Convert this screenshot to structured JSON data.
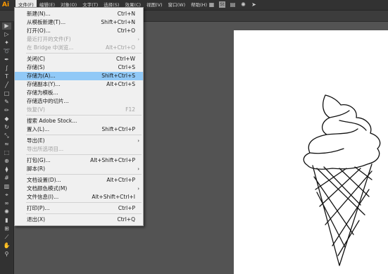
{
  "app": {
    "logo": "Ai"
  },
  "menubar": {
    "items": [
      {
        "label": "文件(F)",
        "active": true
      },
      {
        "label": "编辑(E)"
      },
      {
        "label": "对象(O)"
      },
      {
        "label": "文字(T)"
      },
      {
        "label": "选择(S)"
      },
      {
        "label": "效果(C)"
      },
      {
        "label": "视图(V)"
      },
      {
        "label": "窗口(W)"
      },
      {
        "label": "帮助(H)"
      }
    ],
    "icons": [
      "grid-icon",
      "stock-icon",
      "layout-icon",
      "star-burst-icon",
      "send-icon"
    ]
  },
  "file_menu": {
    "items": [
      {
        "label": "新建(N)...",
        "shortcut": "Ctrl+N"
      },
      {
        "label": "从模板新建(T)...",
        "shortcut": "Shift+Ctrl+N"
      },
      {
        "label": "打开(O)...",
        "shortcut": "Ctrl+O"
      },
      {
        "label": "最近打开的文件(F)",
        "shortcut": "",
        "submenu": true,
        "disabled": true
      },
      {
        "label": "在 Bridge 中浏览...",
        "shortcut": "Alt+Ctrl+O",
        "disabled": true
      },
      {
        "label": "关闭(C)",
        "shortcut": "Ctrl+W"
      },
      {
        "label": "存储(S)",
        "shortcut": "Ctrl+S"
      },
      {
        "label": "存储为(A)...",
        "shortcut": "Shift+Ctrl+S",
        "highlighted": true
      },
      {
        "label": "存储副本(Y)...",
        "shortcut": "Alt+Ctrl+S"
      },
      {
        "label": "存储为模板...",
        "shortcut": ""
      },
      {
        "label": "存储选中的切片...",
        "shortcut": ""
      },
      {
        "label": "恢复(V)",
        "shortcut": "F12",
        "disabled": true
      },
      {
        "label": "搜索 Adobe Stock...",
        "shortcut": ""
      },
      {
        "label": "置入(L)...",
        "shortcut": "Shift+Ctrl+P"
      },
      {
        "label": "导出(E)",
        "shortcut": "",
        "submenu": true
      },
      {
        "label": "导出所选项目...",
        "shortcut": "",
        "disabled": true
      },
      {
        "label": "打包(G)...",
        "shortcut": "Alt+Shift+Ctrl+P"
      },
      {
        "label": "脚本(R)",
        "shortcut": "",
        "submenu": true
      },
      {
        "label": "文档设置(D)...",
        "shortcut": "Alt+Ctrl+P"
      },
      {
        "label": "文档颜色模式(M)",
        "shortcut": "",
        "submenu": true
      },
      {
        "label": "文件信息(I)...",
        "shortcut": "Alt+Shift+Ctrl+I"
      },
      {
        "label": "打印(P)...",
        "shortcut": "Ctrl+P"
      },
      {
        "label": "退出(X)",
        "shortcut": "Ctrl+Q"
      }
    ]
  },
  "toolbar": {
    "tools": [
      "selection-tool-icon",
      "direct-selection-tool-icon",
      "magic-wand-icon",
      "lasso-icon",
      "pen-tool-icon",
      "curvature-tool-icon",
      "type-tool-icon",
      "line-tool-icon",
      "rectangle-tool-icon",
      "paintbrush-icon",
      "pencil-icon",
      "eraser-icon",
      "rotate-tool-icon",
      "scale-tool-icon",
      "width-tool-icon",
      "free-transform-icon",
      "shape-builder-icon",
      "perspective-grid-icon",
      "mesh-tool-icon",
      "gradient-tool-icon",
      "eyedropper-icon",
      "blend-tool-icon",
      "symbol-sprayer-icon",
      "column-graph-icon",
      "artboard-tool-icon",
      "slice-tool-icon",
      "hand-tool-icon",
      "zoom-tool-icon"
    ]
  },
  "colors": {
    "highlight": "#91c9f7",
    "logo": "#ff9a00",
    "canvas": "#535353"
  }
}
